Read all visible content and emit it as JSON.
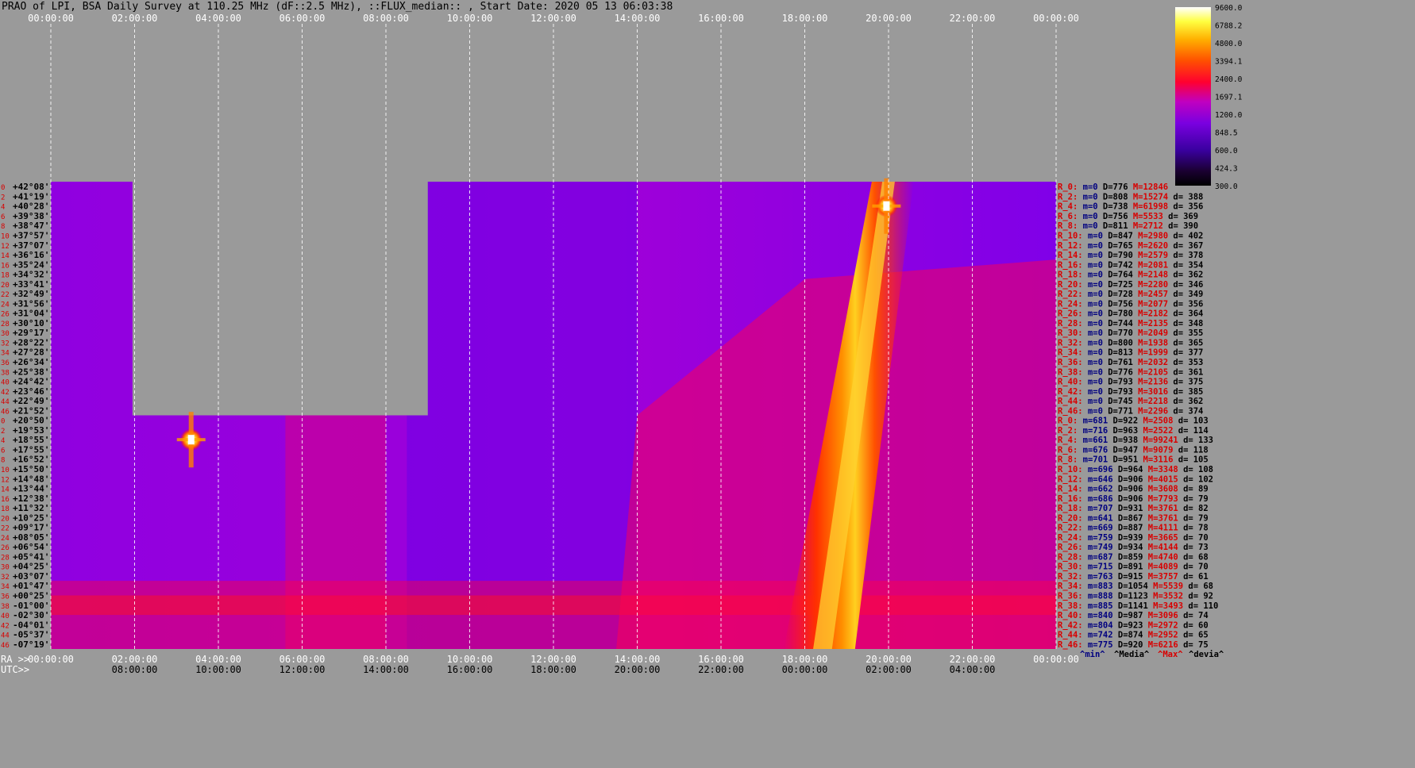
{
  "title": "PRAO of LPI, BSA Daily Survey at 110.25 MHz (dF::2.5 MHz), ::FLUX_median:: , Start Date: 2020 05 13 06:03:38",
  "chart_data": {
    "type": "heatmap",
    "title": "PRAO of LPI, BSA Daily Survey at 110.25 MHz (dF::2.5 MHz), ::FLUX_median:: , Start Date: 2020 05 13 06:03:38",
    "x_ra_ticks": [
      "00:00:00",
      "02:00:00",
      "04:00:00",
      "06:00:00",
      "08:00:00",
      "10:00:00",
      "12:00:00",
      "14:00:00",
      "16:00:00",
      "18:00:00",
      "20:00:00",
      "22:00:00",
      "00:00:00"
    ],
    "x_utc_ticks": [
      "08:00:00",
      "10:00:00",
      "12:00:00",
      "14:00:00",
      "16:00:00",
      "18:00:00",
      "20:00:00",
      "22:00:00",
      "00:00:00",
      "02:00:00",
      "04:00:00"
    ],
    "x_ra_label": "RA >>",
    "x_utc_label": "UTC>>",
    "y_labels": [
      "+42°08'",
      "+41°19'",
      "+40°28'",
      "+39°38'",
      "+38°47'",
      "+37°57'",
      "+37°07'",
      "+36°16'",
      "+35°24'",
      "+34°32'",
      "+33°41'",
      "+32°49'",
      "+31°56'",
      "+31°04'",
      "+30°10'",
      "+29°17'",
      "+28°22'",
      "+27°28'",
      "+26°34'",
      "+25°38'",
      "+24°42'",
      "+23°46'",
      "+22°49'",
      "+21°52'",
      "+20°50'",
      "+19°53'",
      "+18°55'",
      "+17°55'",
      "+16°52'",
      "+15°50'",
      "+14°48'",
      "+13°44'",
      "+12°38'",
      "+11°32'",
      "+10°25'",
      "+09°17'",
      "+08°05'",
      "+06°54'",
      "+05°41'",
      "+04°25'",
      "+03°07'",
      "+01°47'",
      "+00°25'",
      "-01°00'",
      "-02°30'",
      "-04°01'",
      "-05°37'",
      "-07°19'"
    ],
    "row_index_labels": [
      "0",
      "2",
      "4",
      "6",
      "8",
      "10",
      "12",
      "14",
      "16",
      "18",
      "20",
      "22",
      "24",
      "26",
      "28",
      "30",
      "32",
      "34",
      "36",
      "38",
      "40",
      "42",
      "44",
      "46",
      "0",
      "2",
      "4",
      "6",
      "8",
      "10",
      "12",
      "14",
      "16",
      "18",
      "20",
      "22",
      "24",
      "26",
      "28",
      "30",
      "32",
      "34",
      "36",
      "38",
      "40",
      "42",
      "44",
      "46"
    ],
    "colorbar": {
      "ticks": [
        "9600.0",
        "6788.2",
        "4800.0",
        "3394.1",
        "2400.0",
        "1697.1",
        "1200.0",
        "848.5",
        "600.0",
        "424.3",
        "300.0"
      ],
      "range": [
        300,
        9600
      ],
      "scale": "log",
      "colors": [
        "#000000",
        "#1a0030",
        "#3a00a0",
        "#7a00e0",
        "#c000c0",
        "#ff0030",
        "#ff5000",
        "#ffb000",
        "#ffff40",
        "#ffffff"
      ]
    },
    "row_stats": [
      {
        "r": "R_0:",
        "m": "m=0",
        "D": "D=776",
        "M": "M=12846",
        "d": ""
      },
      {
        "r": "R_2:",
        "m": "m=0",
        "D": "D=808",
        "M": "M=15274",
        "d": "d= 388"
      },
      {
        "r": "R_4:",
        "m": "m=0",
        "D": "D=738",
        "M": "M=61998",
        "d": "d= 356"
      },
      {
        "r": "R_6:",
        "m": "m=0",
        "D": "D=756",
        "M": "M=5533",
        "d": "d= 369"
      },
      {
        "r": "R_8:",
        "m": "m=0",
        "D": "D=811",
        "M": "M=2712",
        "d": "d= 390"
      },
      {
        "r": "R_10:",
        "m": "m=0",
        "D": "D=847",
        "M": "M=2980",
        "d": "d= 402"
      },
      {
        "r": "R_12:",
        "m": "m=0",
        "D": "D=765",
        "M": "M=2620",
        "d": "d= 367"
      },
      {
        "r": "R_14:",
        "m": "m=0",
        "D": "D=790",
        "M": "M=2579",
        "d": "d= 378"
      },
      {
        "r": "R_16:",
        "m": "m=0",
        "D": "D=742",
        "M": "M=2081",
        "d": "d= 354"
      },
      {
        "r": "R_18:",
        "m": "m=0",
        "D": "D=764",
        "M": "M=2148",
        "d": "d= 362"
      },
      {
        "r": "R_20:",
        "m": "m=0",
        "D": "D=725",
        "M": "M=2280",
        "d": "d= 346"
      },
      {
        "r": "R_22:",
        "m": "m=0",
        "D": "D=728",
        "M": "M=2457",
        "d": "d= 349"
      },
      {
        "r": "R_24:",
        "m": "m=0",
        "D": "D=756",
        "M": "M=2077",
        "d": "d= 356"
      },
      {
        "r": "R_26:",
        "m": "m=0",
        "D": "D=780",
        "M": "M=2182",
        "d": "d= 364"
      },
      {
        "r": "R_28:",
        "m": "m=0",
        "D": "D=744",
        "M": "M=2135",
        "d": "d= 348"
      },
      {
        "r": "R_30:",
        "m": "m=0",
        "D": "D=770",
        "M": "M=2049",
        "d": "d= 355"
      },
      {
        "r": "R_32:",
        "m": "m=0",
        "D": "D=800",
        "M": "M=1938",
        "d": "d= 365"
      },
      {
        "r": "R_34:",
        "m": "m=0",
        "D": "D=813",
        "M": "M=1999",
        "d": "d= 377"
      },
      {
        "r": "R_36:",
        "m": "m=0",
        "D": "D=761",
        "M": "M=2032",
        "d": "d= 353"
      },
      {
        "r": "R_38:",
        "m": "m=0",
        "D": "D=776",
        "M": "M=2105",
        "d": "d= 361"
      },
      {
        "r": "R_40:",
        "m": "m=0",
        "D": "D=793",
        "M": "M=2136",
        "d": "d= 375"
      },
      {
        "r": "R_42:",
        "m": "m=0",
        "D": "D=793",
        "M": "M=3016",
        "d": "d= 385"
      },
      {
        "r": "R_44:",
        "m": "m=0",
        "D": "D=745",
        "M": "M=2218",
        "d": "d= 362"
      },
      {
        "r": "R_46:",
        "m": "m=0",
        "D": "D=771",
        "M": "M=2296",
        "d": "d= 374"
      },
      {
        "r": "R_0:",
        "m": "m=681",
        "D": "D=922",
        "M": "M=2508",
        "d": "d= 103"
      },
      {
        "r": "R_2:",
        "m": "m=716",
        "D": "D=963",
        "M": "M=2522",
        "d": "d= 114"
      },
      {
        "r": "R_4:",
        "m": "m=661",
        "D": "D=938",
        "M": "M=99241",
        "d": "d= 133"
      },
      {
        "r": "R_6:",
        "m": "m=676",
        "D": "D=947",
        "M": "M=9079",
        "d": "d= 118"
      },
      {
        "r": "R_8:",
        "m": "m=701",
        "D": "D=951",
        "M": "M=3116",
        "d": "d= 105"
      },
      {
        "r": "R_10:",
        "m": "m=696",
        "D": "D=964",
        "M": "M=3348",
        "d": "d= 108"
      },
      {
        "r": "R_12:",
        "m": "m=646",
        "D": "D=906",
        "M": "M=4015",
        "d": "d= 102"
      },
      {
        "r": "R_14:",
        "m": "m=662",
        "D": "D=906",
        "M": "M=3608",
        "d": "d= 89"
      },
      {
        "r": "R_16:",
        "m": "m=686",
        "D": "D=906",
        "M": "M=7793",
        "d": "d= 79"
      },
      {
        "r": "R_18:",
        "m": "m=707",
        "D": "D=931",
        "M": "M=3761",
        "d": "d= 82"
      },
      {
        "r": "R_20:",
        "m": "m=641",
        "D": "D=867",
        "M": "M=3761",
        "d": "d= 79"
      },
      {
        "r": "R_22:",
        "m": "m=669",
        "D": "D=887",
        "M": "M=4111",
        "d": "d= 78"
      },
      {
        "r": "R_24:",
        "m": "m=759",
        "D": "D=939",
        "M": "M=3665",
        "d": "d= 70"
      },
      {
        "r": "R_26:",
        "m": "m=749",
        "D": "D=934",
        "M": "M=4144",
        "d": "d= 73"
      },
      {
        "r": "R_28:",
        "m": "m=687",
        "D": "D=859",
        "M": "M=4740",
        "d": "d= 68"
      },
      {
        "r": "R_30:",
        "m": "m=715",
        "D": "D=891",
        "M": "M=4089",
        "d": "d= 70"
      },
      {
        "r": "R_32:",
        "m": "m=763",
        "D": "D=915",
        "M": "M=3757",
        "d": "d= 61"
      },
      {
        "r": "R_34:",
        "m": "m=883",
        "D": "D=1054",
        "M": "M=5539",
        "d": "d= 68"
      },
      {
        "r": "R_36:",
        "m": "m=888",
        "D": "D=1123",
        "M": "M=3532",
        "d": "d= 92"
      },
      {
        "r": "R_38:",
        "m": "m=885",
        "D": "D=1141",
        "M": "M=3493",
        "d": "d= 110"
      },
      {
        "r": "R_40:",
        "m": "m=840",
        "D": "D=987",
        "M": "M=3096",
        "d": "d= 74"
      },
      {
        "r": "R_42:",
        "m": "m=804",
        "D": "D=923",
        "M": "M=2972",
        "d": "d= 60"
      },
      {
        "r": "R_44:",
        "m": "m=742",
        "D": "D=874",
        "M": "M=2952",
        "d": "d= 65"
      },
      {
        "r": "R_46:",
        "m": "m=775",
        "D": "D=920",
        "M": "M=6216",
        "d": "d= 75"
      }
    ],
    "stats_legend": [
      "^min^",
      "^Media^",
      "^Max^",
      "^devia^"
    ],
    "sources": [
      {
        "name": "",
        "ra_h": 19.95,
        "row": 2,
        "peak": 61998
      },
      {
        "name": "",
        "ra_h": 3.35,
        "row": 26,
        "peak": 99241
      }
    ],
    "colors": {
      "background": "#9a9a9a",
      "grid": "#ffffff",
      "label_red": "#d80000",
      "label_blue": "#000080"
    }
  }
}
